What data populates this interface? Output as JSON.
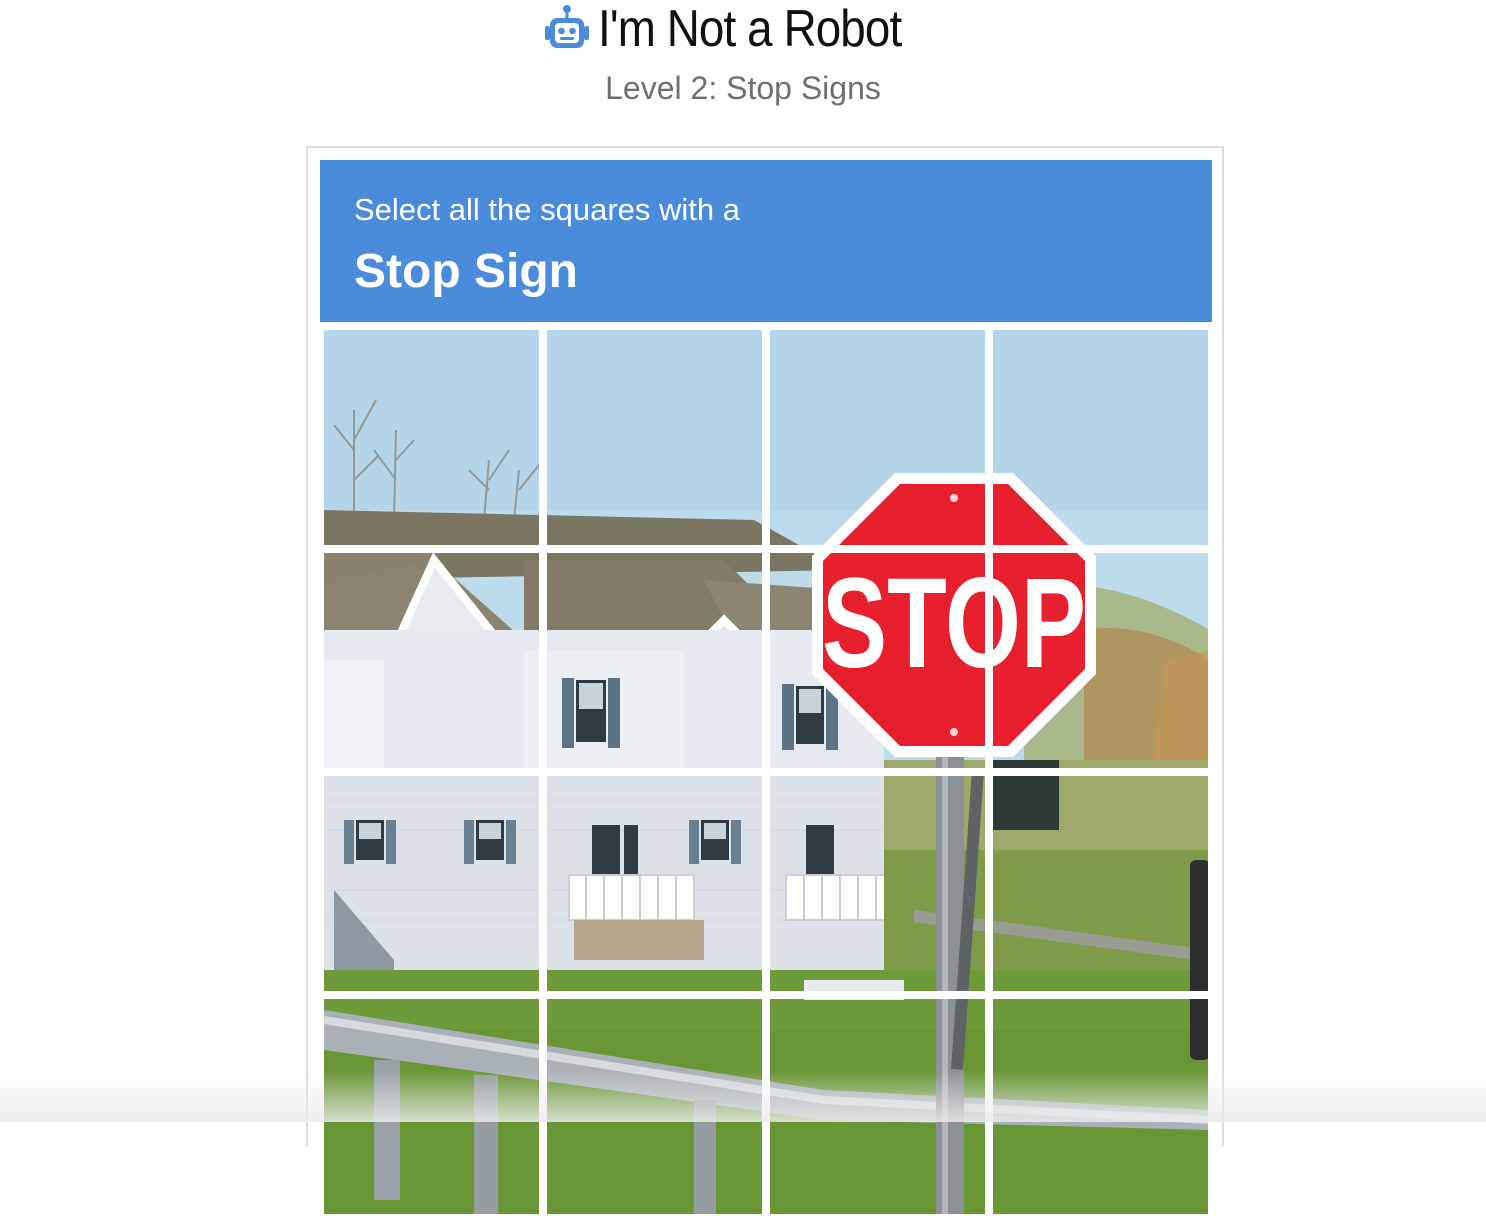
{
  "header": {
    "title": "I'm Not a Robot",
    "subtitle": "Level 2: Stop Signs",
    "icon": "robot-icon"
  },
  "captcha": {
    "instruction": "Select all the squares with a",
    "target": "Stop Sign",
    "grid_rows": 4,
    "grid_cols": 4,
    "sign_text": "STOP"
  },
  "colors": {
    "accent": "#4a8bdb",
    "sign_red": "#e8202d",
    "sky": "#b9d9ea",
    "grass": "#6f9b3c"
  }
}
